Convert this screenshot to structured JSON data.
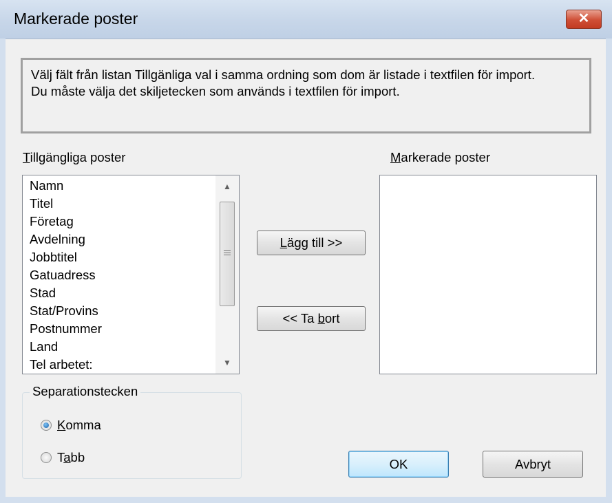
{
  "window": {
    "title": "Markerade poster",
    "close_glyph": "✕"
  },
  "info": {
    "line1": "Välj fält från listan Tillgänliga val i samma ordning som dom är listade i textfilen för import.",
    "line2": "Du måste välja det skiljetecken som används i textfilen för import."
  },
  "available": {
    "label_mnemonic": "T",
    "label_rest": "illgängliga poster",
    "items": [
      "Namn",
      "Titel",
      "Företag",
      "Avdelning",
      "Jobbtitel",
      "Gatuadress",
      "Stad",
      "Stat/Provins",
      "Postnummer",
      "Land",
      "Tel arbetet:"
    ]
  },
  "selected": {
    "label_mnemonic": "M",
    "label_rest": "arkerade poster",
    "items": []
  },
  "buttons": {
    "add": {
      "mnemonic": "L",
      "rest": "ägg till >>"
    },
    "remove": {
      "pre": "<< Ta ",
      "mnemonic": "b",
      "rest": "ort"
    },
    "ok": "OK",
    "cancel": "Avbryt"
  },
  "separator": {
    "legend": "Separationstecken",
    "options": [
      {
        "mnemonic": "K",
        "rest": "omma",
        "checked": true
      },
      {
        "pre": "T",
        "mnemonic": "a",
        "rest": "bb",
        "checked": false
      }
    ]
  },
  "icons": {
    "scroll_up": "scroll-up-arrow-icon",
    "scroll_down": "scroll-down-arrow-icon",
    "close": "close-icon",
    "radio": "radio-button-icon"
  }
}
